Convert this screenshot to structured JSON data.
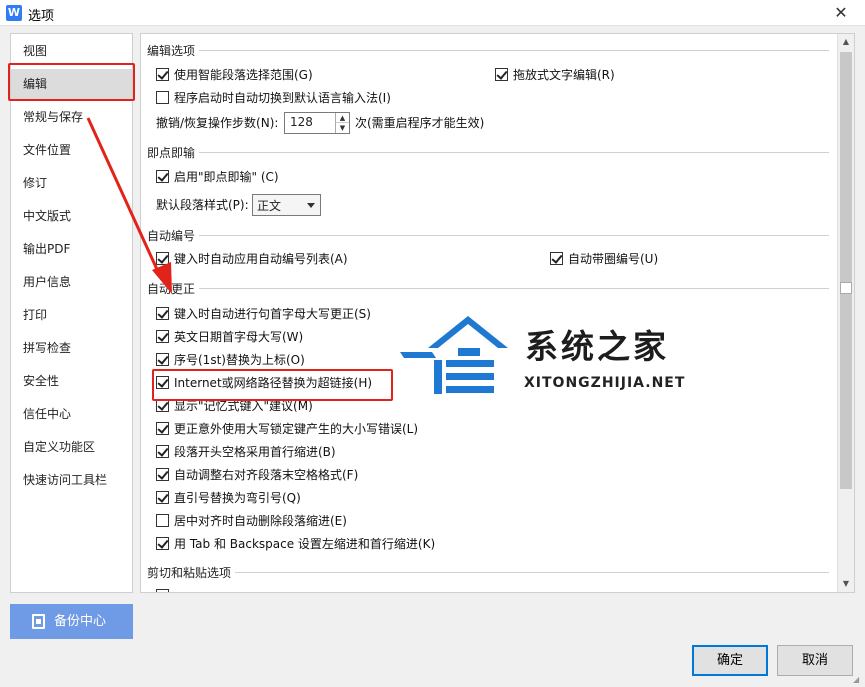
{
  "window": {
    "title": "选项",
    "app_icon_letter": "W",
    "close_glyph": "✕"
  },
  "sidebar": {
    "items": [
      {
        "label": "视图"
      },
      {
        "label": "编辑"
      },
      {
        "label": "常规与保存"
      },
      {
        "label": "文件位置"
      },
      {
        "label": "修订"
      },
      {
        "label": "中文版式"
      },
      {
        "label": "输出PDF"
      },
      {
        "label": "用户信息"
      },
      {
        "label": "打印"
      },
      {
        "label": "拼写检查"
      },
      {
        "label": "安全性"
      },
      {
        "label": "信任中心"
      },
      {
        "label": "自定义功能区"
      },
      {
        "label": "快速访问工具栏"
      }
    ],
    "active_index": 1,
    "backup_label": "备份中心"
  },
  "main": {
    "edit_section": {
      "heading": "编辑选项",
      "smart_para": {
        "label": "使用智能段落选择范围(G)",
        "checked": true
      },
      "drag_edit": {
        "label": "拖放式文字编辑(R)",
        "checked": true
      },
      "ime_switch": {
        "label": "程序启动时自动切换到默认语言输入法(I)",
        "checked": false
      },
      "undo_label": "撤销/恢复操作步数(N):",
      "undo_value": "128",
      "undo_suffix": "次(需重启程序才能生效)"
    },
    "click_type": {
      "heading": "即点即输",
      "enable": {
        "label": "启用\"即点即输\" (C)",
        "checked": true
      },
      "default_style_label": "默认段落样式(P):",
      "default_style_value": "正文"
    },
    "auto_number": {
      "heading": "自动编号",
      "auto_list": {
        "label": "键入时自动应用自动编号列表(A)",
        "checked": true
      },
      "auto_circle": {
        "label": "自动带圈编号(U)",
        "checked": true
      }
    },
    "auto_correct": {
      "heading": "自动更正",
      "items": [
        {
          "label": "键入时自动进行句首字母大写更正(S)",
          "checked": true
        },
        {
          "label": "英文日期首字母大写(W)",
          "checked": true
        },
        {
          "label": "序号(1st)替换为上标(O)",
          "checked": true
        },
        {
          "label": "Internet或网络路径替换为超链接(H)",
          "checked": true
        },
        {
          "label": "显示\"记忆式键入\"建议(M)",
          "checked": true
        },
        {
          "label": "更正意外使用大写锁定键产生的大小写错误(L)",
          "checked": true
        },
        {
          "label": "段落开头空格采用首行缩进(B)",
          "checked": true
        },
        {
          "label": "自动调整右对齐段落末空格格式(F)",
          "checked": true
        },
        {
          "label": "直引号替换为弯引号(Q)",
          "checked": true
        },
        {
          "label": "居中对齐时自动删除段落缩进(E)",
          "checked": false
        },
        {
          "label": "用 Tab 和 Backspace 设置左缩进和首行缩进(K)",
          "checked": true
        }
      ]
    },
    "clipboard": {
      "heading": "剪切和粘贴选项"
    }
  },
  "watermark": {
    "title": "系统之家",
    "url": "XITONGZHIJIA.NET"
  },
  "footer": {
    "ok_label": "确定",
    "cancel_label": "取消"
  },
  "colors": {
    "highlight_red": "#e2231a",
    "backup_blue": "#6e9ae6",
    "primary_border": "#0078d7",
    "logo_blue": "#1f78d1"
  }
}
